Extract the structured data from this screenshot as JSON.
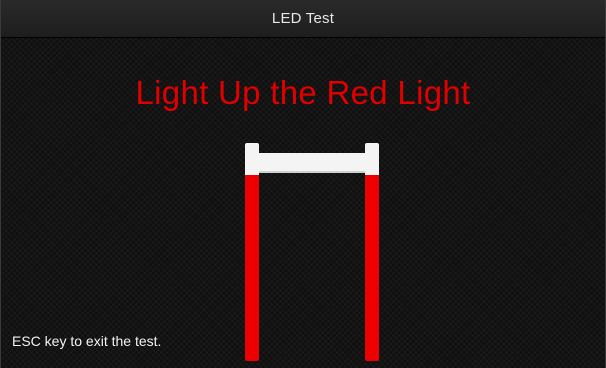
{
  "window": {
    "title": "LED Test"
  },
  "main": {
    "instruction": "Light Up the Red Light",
    "hint": "ESC key to exit the test."
  },
  "colors": {
    "accent": "#e00000",
    "led_on": "#ee0000",
    "led_off": "#f4f4f4"
  },
  "led": {
    "left_post": "on",
    "right_post": "on",
    "crossbar": "off"
  }
}
